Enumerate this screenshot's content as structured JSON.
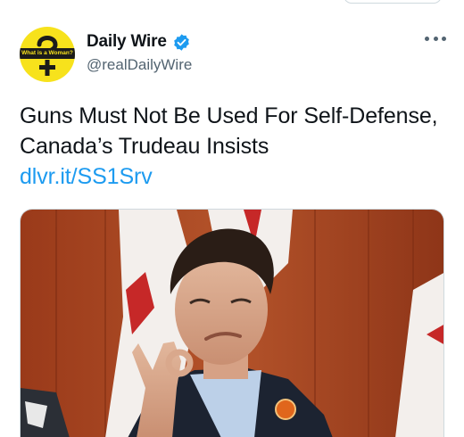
{
  "account": {
    "display_name": "Daily Wire",
    "handle": "@realDailyWire",
    "avatar_text": "What is a Woman?"
  },
  "tweet": {
    "text": "Guns Must Not Be Used For Self-Defense, Canada’s Trudeau Insists",
    "link": "dlvr.it/SS1Srv"
  },
  "icons": {
    "verified": "verified-badge-icon",
    "more": "more-options-icon"
  },
  "colors": {
    "link": "#1d9bf0",
    "verified": "#1d9bf0",
    "handle": "#536471",
    "avatar_bg": "#f7e21c"
  }
}
